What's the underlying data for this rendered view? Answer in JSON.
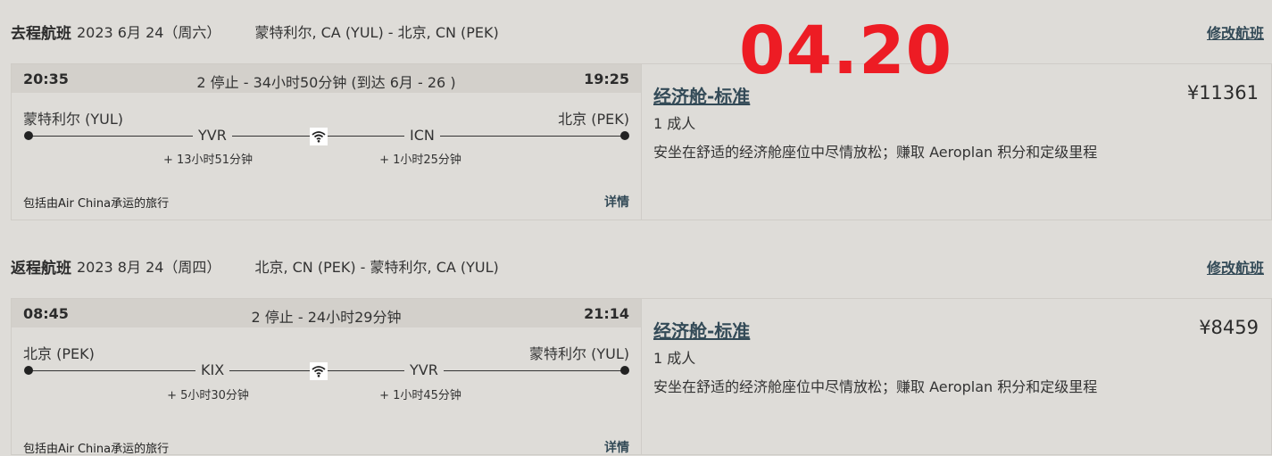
{
  "outbound": {
    "kind": "去程航班",
    "date": "2023 6月 24（周六）",
    "route": "蒙特利尔, CA (YUL) - 北京, CN (PEK)",
    "change_label": "修改航班",
    "dep_time": "20:35",
    "arr_time": "19:25",
    "summary": "2 停止 - 34小时50分钟 (到达 6月 - 26 )",
    "from_city": "蒙特利尔 (YUL)",
    "to_city": "北京 (PEK)",
    "stop1_code": "YVR",
    "stop2_code": "ICN",
    "stop1_layover": "+ 13小时51分钟",
    "stop2_layover": "+ 1小时25分钟",
    "operated": "包括由Air China承运的旅行",
    "details_label": "详情",
    "cabin": "经济舱-标准",
    "price": "¥11361",
    "pax": "1 成人",
    "desc": "安坐在舒适的经济舱座位中尽情放松；赚取 Aeroplan 积分和定级里程"
  },
  "return": {
    "kind": "返程航班",
    "date": "2023 8月 24（周四）",
    "route": "北京, CN (PEK) - 蒙特利尔, CA (YUL)",
    "change_label": "修改航班",
    "dep_time": "08:45",
    "arr_time": "21:14",
    "summary": "2 停止 - 24小时29分钟",
    "from_city": "北京 (PEK)",
    "to_city": "蒙特利尔 (YUL)",
    "stop1_code": "KIX",
    "stop2_code": "YVR",
    "stop1_layover": "+ 5小时30分钟",
    "stop2_layover": "+ 1小时45分钟",
    "operated": "包括由Air China承运的旅行",
    "details_label": "详情",
    "cabin": "经济舱-标准",
    "price": "¥8459",
    "pax": "1 成人",
    "desc": "安坐在舒适的经济舱座位中尽情放松；赚取 Aeroplan 积分和定级里程"
  },
  "overlay_date": "04.20",
  "icons": {
    "wifi": "wifi-icon"
  },
  "colors": {
    "link": "#334a57",
    "overlay": "#ed1c24",
    "bar": "#d3d0cb",
    "background": "#dedcd8"
  }
}
